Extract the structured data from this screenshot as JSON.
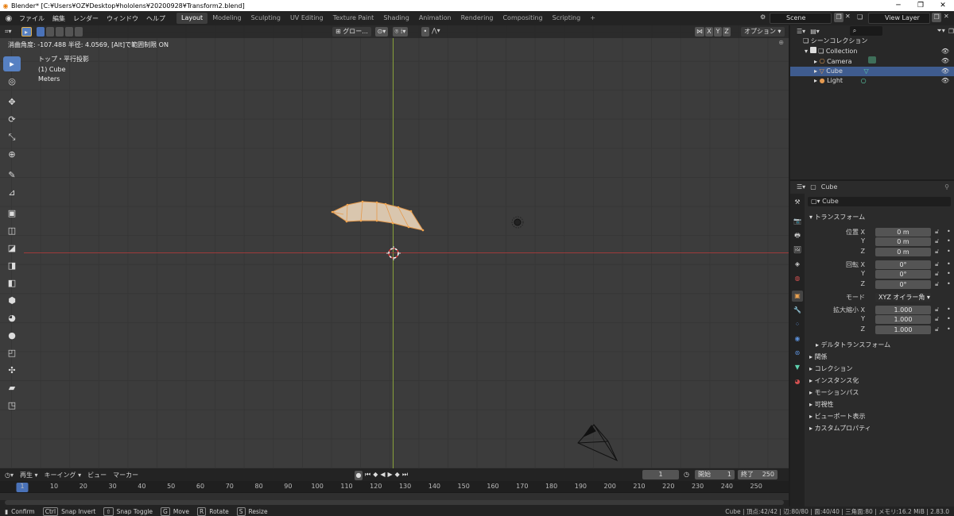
{
  "window": {
    "title": "Blender* [C:¥Users¥OZ¥Desktop¥hololens¥20200928¥Transform2.blend]"
  },
  "menu": [
    "ファイル",
    "編集",
    "レンダー",
    "ウィンドウ",
    "ヘルプ"
  ],
  "workspaces": [
    "Layout",
    "Modeling",
    "Sculpting",
    "UV Editing",
    "Texture Paint",
    "Shading",
    "Animation",
    "Rendering",
    "Compositing",
    "Scripting"
  ],
  "scene": {
    "name": "Scene",
    "view_layer": "View Layer"
  },
  "viewport": {
    "hint": "消曲角度: -107.488 半径: 4.0569, [Alt]で範囲制限 ON",
    "overlay_view": "トップ・平行投影",
    "overlay_object": "(1) Cube",
    "overlay_units": "Meters",
    "transform_orientation": "グロー...",
    "options_label": "オプション",
    "axis_x": "X",
    "axis_y": "Y",
    "axis_z": "Z"
  },
  "timeline": {
    "menu": [
      "再生",
      "キーイング",
      "ビュー",
      "マーカー"
    ],
    "current_frame": "1",
    "start_label": "開始",
    "start": "1",
    "end_label": "終了",
    "end": "250",
    "ticks": [
      "1",
      "10",
      "20",
      "30",
      "40",
      "50",
      "60",
      "70",
      "80",
      "90",
      "100",
      "110",
      "120",
      "130",
      "140",
      "150",
      "160",
      "170",
      "180",
      "190",
      "200",
      "210",
      "220",
      "230",
      "240",
      "250"
    ]
  },
  "status": {
    "confirm": "Confirm",
    "snap_invert": "Snap Invert",
    "snap_toggle": "Snap Toggle",
    "move": "Move",
    "rotate": "Rotate",
    "resize": "Resize",
    "key_g": "G",
    "key_r": "R",
    "key_s": "S",
    "key_ctrl": "Ctrl",
    "key_shift": "⇧",
    "info": "Cube | 頂点:42/42 | 辺:80/80 | 面:40/40 | 三角面:80 | メモリ:16.2 MiB | 2.83.0"
  },
  "outliner": {
    "root": "シーンコレクション",
    "collection": "Collection",
    "items": [
      {
        "name": "Camera"
      },
      {
        "name": "Cube"
      },
      {
        "name": "Light"
      }
    ]
  },
  "properties": {
    "object_name": "Cube",
    "datablock": "Cube",
    "transform_label": "トランスフォーム",
    "location_label": "位置 X",
    "rotation_label": "回転 X",
    "scale_label": "拡大縮小 X",
    "y": "Y",
    "z": "Z",
    "location": [
      "0 m",
      "0 m",
      "0 m"
    ],
    "rotation": [
      "0°",
      "0°",
      "0°"
    ],
    "mode_label": "モード",
    "mode": "XYZ オイラー角",
    "scale": [
      "1.000",
      "1.000",
      "1.000"
    ],
    "delta": "デルタトランスフォーム",
    "sections": [
      "関係",
      "コレクション",
      "インスタンス化",
      "モーションパス",
      "可視性",
      "ビューポート表示",
      "カスタムプロパティ"
    ]
  },
  "colors": {
    "accent": "#4a72b8",
    "selected_mesh": "#e69a4c",
    "mesh_face": "#d9c6ae",
    "x_axis": "#9d3b3b",
    "y_axis": "#88a13a"
  }
}
